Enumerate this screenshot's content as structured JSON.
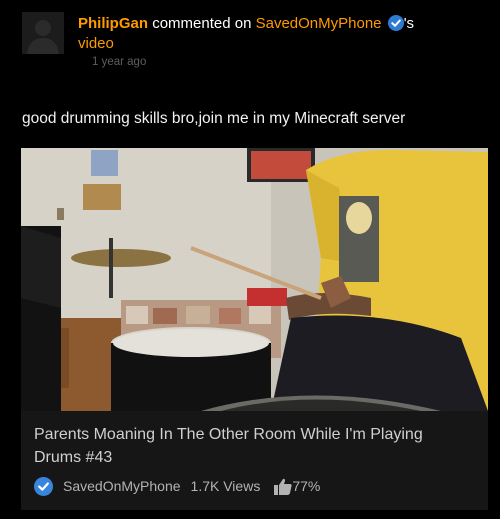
{
  "comment_header": {
    "user": "PhilipGan",
    "action": "commented on",
    "channel": "SavedOnMyPhone",
    "suffix_possessive": "'s",
    "suffix_line2": "video"
  },
  "timestamp": "1 year ago",
  "comment_text": "good drumming skills bro,join me in my Minecraft server",
  "video": {
    "title": "Parents Moaning In The Other Room While I'm Playing Drums #43",
    "channel": "SavedOnMyPhone",
    "views": "1.7K Views",
    "rating": "77%"
  },
  "icons": {
    "avatar": "default-user-avatar",
    "verified": "verified-check-icon",
    "rating": "thumbs-up-icon"
  },
  "colors": {
    "background": "#000000",
    "username": "#ff9a00",
    "verified": "#2d7bd3",
    "timestamp": "#5e5e5e",
    "card": "#161616"
  }
}
